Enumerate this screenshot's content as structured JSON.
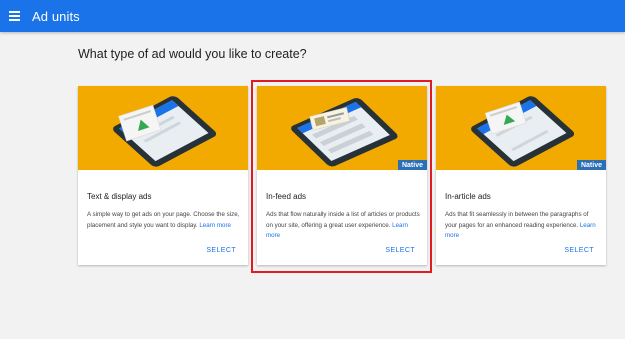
{
  "appbar": {
    "menu_icon": "hamburger-menu-icon",
    "title": "Ad units",
    "color": "#1a73e8"
  },
  "heading": "What type of ad would you like to create?",
  "accent": "#f2a900",
  "cards": [
    {
      "title": "Text & display ads",
      "description": "A simple way to get ads on your page. Choose the size, placement and style you want to display.",
      "learn_more": "Learn more",
      "badge": "",
      "select": "SELECT"
    },
    {
      "title": "In-feed ads",
      "description": "Ads that flow naturally inside a list of articles or products on your site, offering a great user experience.",
      "learn_more": "Learn more",
      "badge": "Native",
      "select": "SELECT"
    },
    {
      "title": "In-article ads",
      "description": "Ads that fit seamlessly in between the paragraphs of your pages for an enhanced reading experience.",
      "learn_more": "Learn more",
      "badge": "Native",
      "select": "SELECT"
    }
  ]
}
